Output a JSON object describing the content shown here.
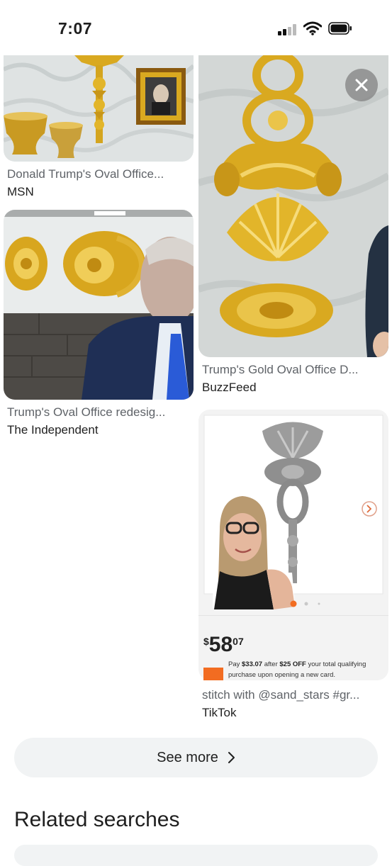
{
  "status_bar": {
    "time": "7:07"
  },
  "results": [
    {
      "title": "Donald Trump's Oval Office...",
      "source": "MSN"
    },
    {
      "title": "Trump's Oval Office redesig...",
      "source": "The Independent"
    },
    {
      "title": "Trump's Gold Oval Office D...",
      "source": "BuzzFeed"
    },
    {
      "title": "stitch with @sand_stars #gr...",
      "source": "TikTok"
    }
  ],
  "tiktok_overlay": {
    "price_dollar": "$",
    "price_main": "58",
    "price_cents": "07",
    "promo_prefix": "Pay ",
    "promo_amount": "$33.07",
    "promo_mid": " after ",
    "promo_off": "$25 OFF",
    "promo_suffix": " your total qualifying purchase upon opening a new card."
  },
  "see_more_label": "See more",
  "related_searches_heading": "Related searches",
  "icons": [
    "signal-icon",
    "wifi-icon",
    "battery-icon",
    "close-icon",
    "chevron-right-icon"
  ],
  "colors": {
    "gold": "#d9a920",
    "wall": "#d8dcdc",
    "suit": "#1f2f55",
    "tie": "#2a5bd7",
    "pill": "#f1f3f4"
  }
}
